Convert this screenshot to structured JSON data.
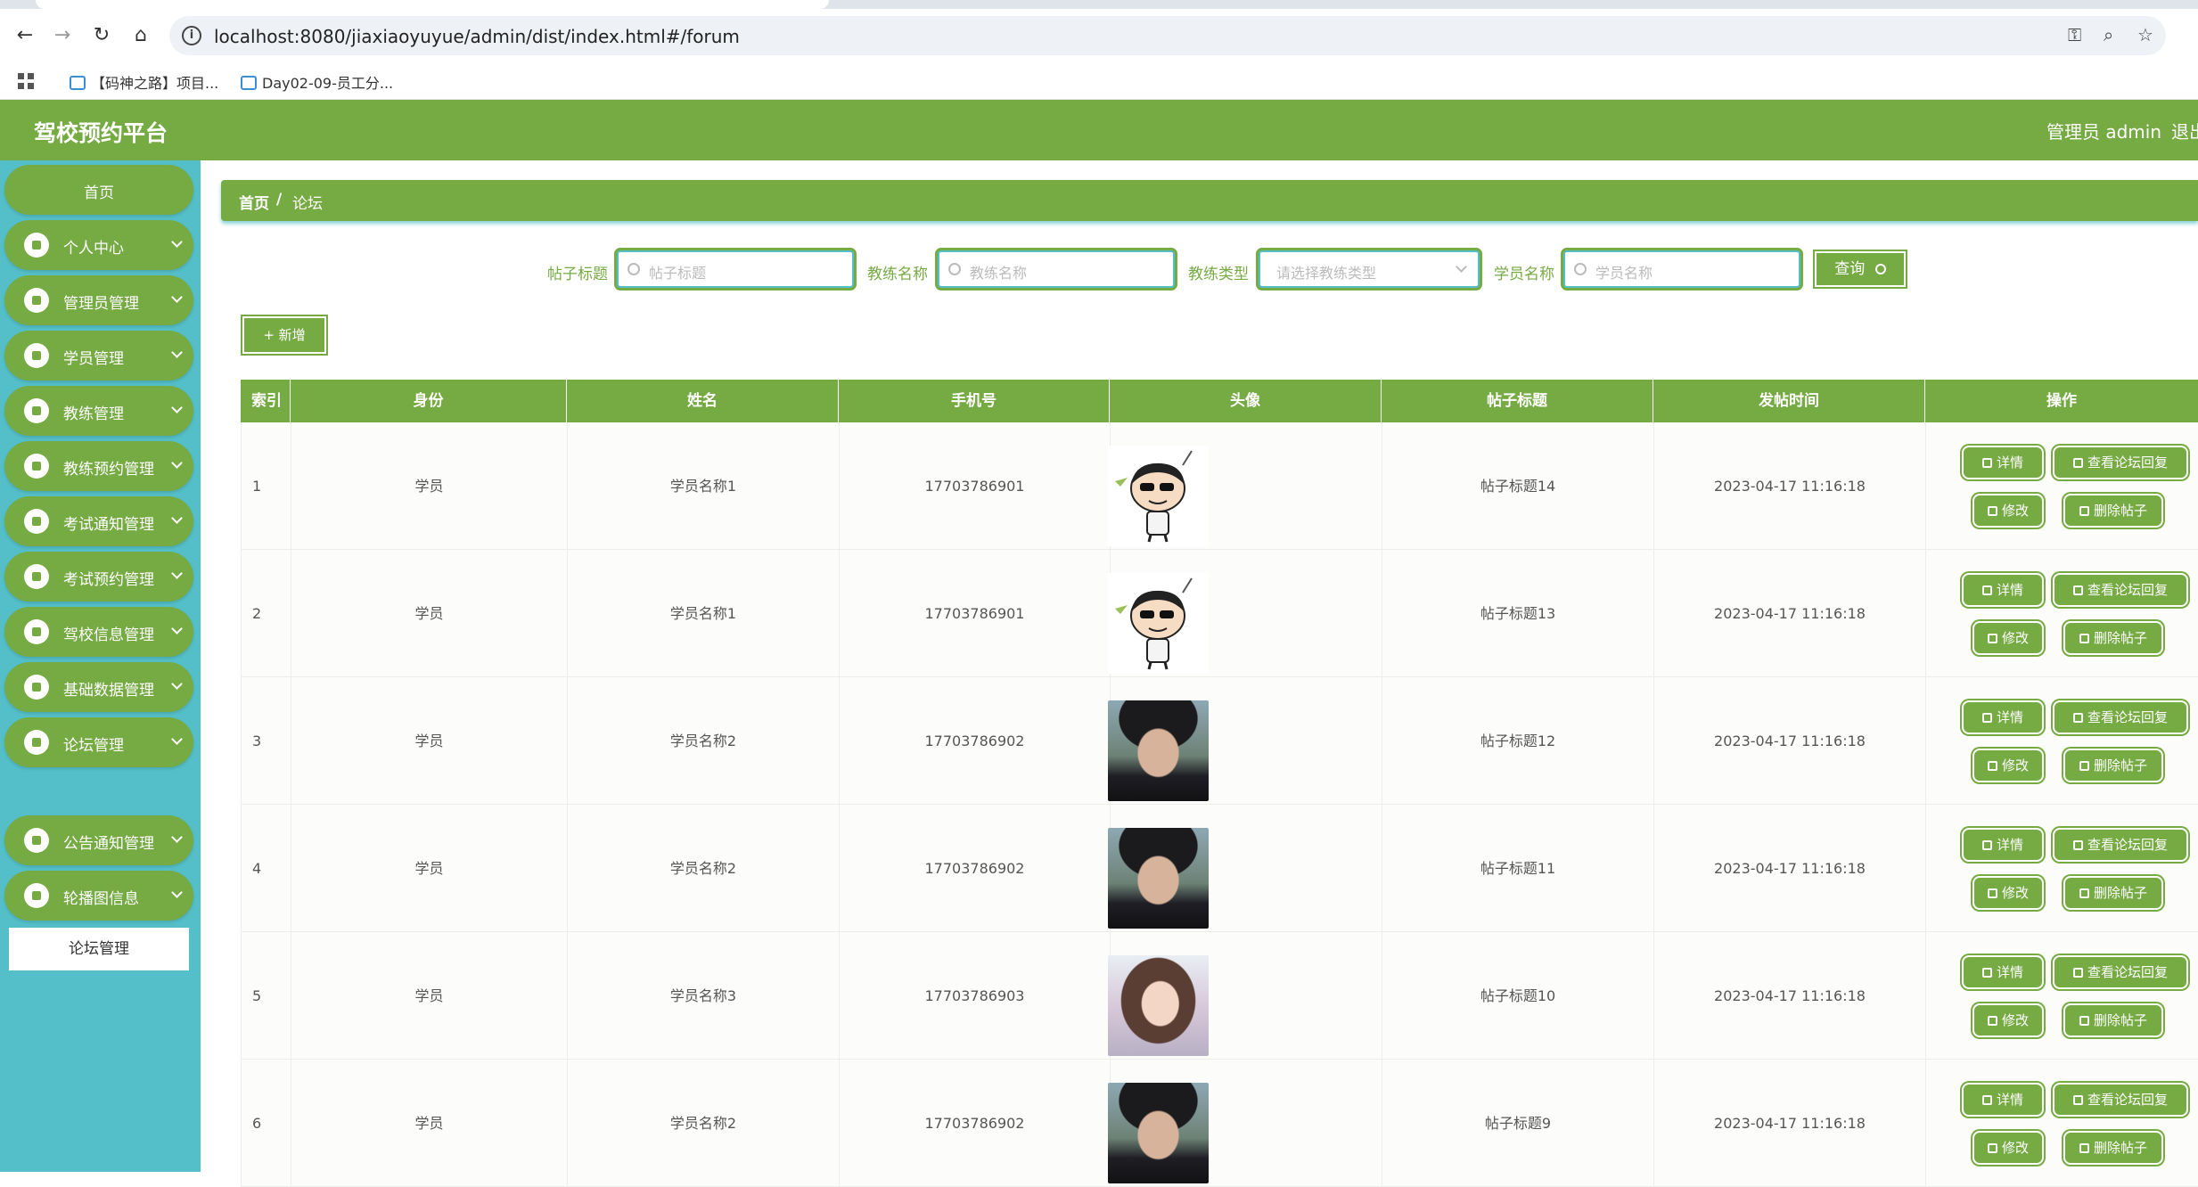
{
  "browser": {
    "url": "localhost:8080/jiaxiaoyuyue/admin/dist/index.html#/forum",
    "bookmarks": [
      {
        "label": "【码神之路】项目..."
      },
      {
        "label": "Day02-09-员工分..."
      }
    ]
  },
  "header": {
    "brand": "驾校预约平台",
    "admin_label": "管理员 admin",
    "logout_label": "退出"
  },
  "sidebar": {
    "items": [
      {
        "label": "首页",
        "icon": "home-icon"
      },
      {
        "label": "个人中心",
        "icon": "user-icon"
      },
      {
        "label": "管理员管理",
        "icon": "grid-icon"
      },
      {
        "label": "学员管理",
        "icon": "flag-icon"
      },
      {
        "label": "教练管理",
        "icon": "briefcase-icon"
      },
      {
        "label": "教练预约管理",
        "icon": "grid-icon"
      },
      {
        "label": "考试通知管理",
        "icon": "clipboard-icon"
      },
      {
        "label": "考试预约管理",
        "icon": "chat-icon"
      },
      {
        "label": "驾校信息管理",
        "icon": "grid-icon"
      },
      {
        "label": "基础数据管理",
        "icon": "wallet-icon"
      },
      {
        "label": "论坛管理",
        "icon": "grid-icon"
      },
      {
        "label": "公告通知管理",
        "icon": "person-icon"
      },
      {
        "label": "轮播图信息",
        "icon": "grid-icon"
      }
    ],
    "submenu_label": "论坛管理"
  },
  "breadcrumb": {
    "home": "首页",
    "separator": "/",
    "current": "论坛"
  },
  "filters": {
    "title_label": "帖子标题",
    "title_placeholder": "帖子标题",
    "coach_label": "教练名称",
    "coach_placeholder": "教练名称",
    "coach_type_label": "教练类型",
    "coach_type_placeholder": "请选择教练类型",
    "student_label": "学员名称",
    "student_placeholder": "学员名称",
    "query_label": "查询"
  },
  "toolbar": {
    "add_label": "+ 新增"
  },
  "table": {
    "columns": [
      "索引",
      "身份",
      "姓名",
      "手机号",
      "头像",
      "帖子标题",
      "发帖时间",
      "操作"
    ],
    "rows": [
      {
        "index": "1",
        "role": "学员",
        "name": "学员名称1",
        "phone": "17703786901",
        "avatar": "cartoon",
        "title": "帖子标题14",
        "time": "2023-04-17 11:16:18"
      },
      {
        "index": "2",
        "role": "学员",
        "name": "学员名称1",
        "phone": "17703786901",
        "avatar": "cartoon",
        "title": "帖子标题13",
        "time": "2023-04-17 11:16:18"
      },
      {
        "index": "3",
        "role": "学员",
        "name": "学员名称2",
        "phone": "17703786902",
        "avatar": "photo-m",
        "title": "帖子标题12",
        "time": "2023-04-17 11:16:18"
      },
      {
        "index": "4",
        "role": "学员",
        "name": "学员名称2",
        "phone": "17703786902",
        "avatar": "photo-m",
        "title": "帖子标题11",
        "time": "2023-04-17 11:16:18"
      },
      {
        "index": "5",
        "role": "学员",
        "name": "学员名称3",
        "phone": "17703786903",
        "avatar": "photo-f",
        "title": "帖子标题10",
        "time": "2023-04-17 11:16:18"
      },
      {
        "index": "6",
        "role": "学员",
        "name": "学员名称2",
        "phone": "17703786902",
        "avatar": "photo-m",
        "title": "帖子标题9",
        "time": "2023-04-17 11:16:18"
      }
    ],
    "actions": {
      "detail": "详情",
      "replies": "查看论坛回复",
      "edit": "修改",
      "delete": "删除帖子"
    }
  },
  "colors": {
    "primary_green": "#76aa43",
    "sidebar_teal": "#54bfc8"
  }
}
